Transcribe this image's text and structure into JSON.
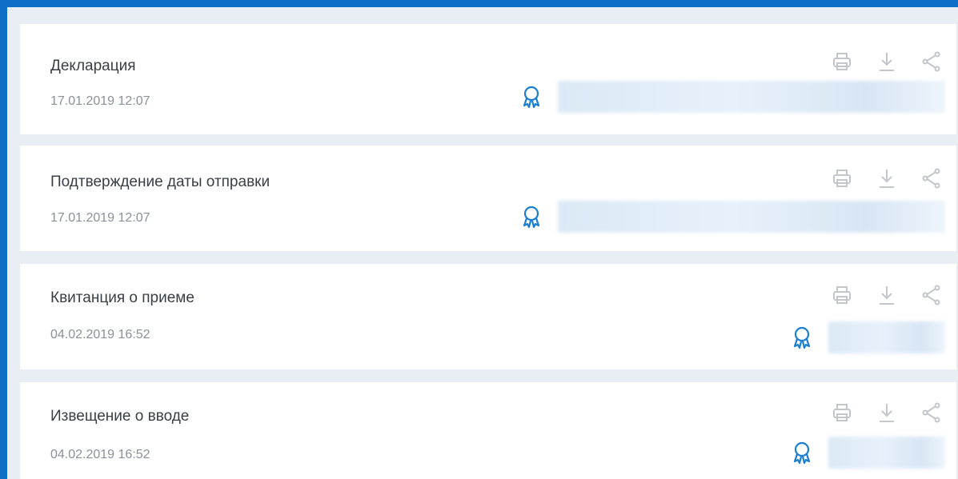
{
  "documents": [
    {
      "title": "Декларация",
      "date": "17.01.2019 12:07"
    },
    {
      "title": "Подтверждение даты отправки",
      "date": "17.01.2019 12:07"
    },
    {
      "title": "Квитанция о приеме",
      "date": "04.02.2019 16:52"
    },
    {
      "title": "Извещение о вводе",
      "date": "04.02.2019 16:52"
    }
  ],
  "icons": {
    "print": "printer-icon",
    "download": "download-icon",
    "share": "share-icon",
    "signature": "certificate-icon"
  },
  "colors": {
    "accent": "#0f6fc7",
    "icon_gray": "#c3c7cc",
    "signature_icon": "#1a7fd1",
    "background": "#e9eef4"
  }
}
